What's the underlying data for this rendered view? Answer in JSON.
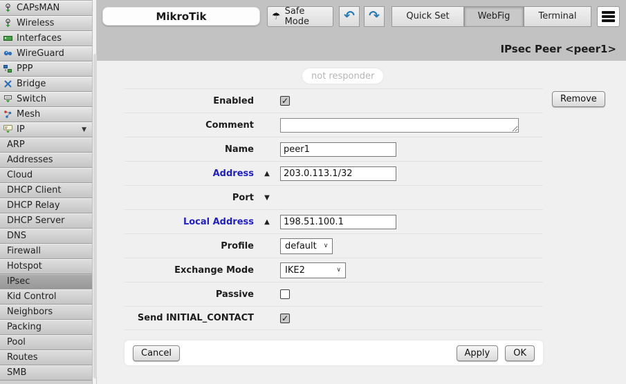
{
  "header": {
    "brand": "MikroTik",
    "safe_mode_label": "Safe Mode",
    "quick_set_label": "Quick Set",
    "webfig_label": "WebFig",
    "terminal_label": "Terminal"
  },
  "page": {
    "title": "IPsec Peer <peer1>",
    "status_badge": "not responder"
  },
  "sidebar": {
    "items": [
      {
        "label": "CAPsMAN",
        "icon": "antenna"
      },
      {
        "label": "Wireless",
        "icon": "antenna"
      },
      {
        "label": "Interfaces",
        "icon": "interface-card"
      },
      {
        "label": "WireGuard",
        "icon": "wireguard"
      },
      {
        "label": "PPP",
        "icon": "ppp"
      },
      {
        "label": "Bridge",
        "icon": "bridge"
      },
      {
        "label": "Switch",
        "icon": "switch"
      },
      {
        "label": "Mesh",
        "icon": "mesh"
      },
      {
        "label": "IP",
        "icon": "ip-label",
        "expanded": true
      }
    ],
    "subitems": [
      {
        "label": "ARP"
      },
      {
        "label": "Addresses"
      },
      {
        "label": "Cloud"
      },
      {
        "label": "DHCP Client"
      },
      {
        "label": "DHCP Relay"
      },
      {
        "label": "DHCP Server"
      },
      {
        "label": "DNS"
      },
      {
        "label": "Firewall"
      },
      {
        "label": "Hotspot"
      },
      {
        "label": "IPsec",
        "selected": true
      },
      {
        "label": "Kid Control"
      },
      {
        "label": "Neighbors"
      },
      {
        "label": "Packing"
      },
      {
        "label": "Pool"
      },
      {
        "label": "Routes"
      },
      {
        "label": "SMB"
      }
    ]
  },
  "form": {
    "enabled_label": "Enabled",
    "enabled_checked": true,
    "comment_label": "Comment",
    "comment_value": "",
    "name_label": "Name",
    "name_value": "peer1",
    "address_label": "Address",
    "address_value": "203.0.113.1/32",
    "port_label": "Port",
    "local_address_label": "Local Address",
    "local_address_value": "198.51.100.1",
    "profile_label": "Profile",
    "profile_value": "default",
    "exchange_mode_label": "Exchange Mode",
    "exchange_mode_value": "IKE2",
    "passive_label": "Passive",
    "passive_checked": false,
    "send_initial_contact_label": "Send INITIAL_CONTACT",
    "send_initial_contact_checked": true
  },
  "buttons": {
    "remove": "Remove",
    "cancel": "Cancel",
    "apply": "Apply",
    "ok": "OK"
  },
  "icons": {
    "check": "✓",
    "triangle_up": "▲",
    "triangle_down": "▼",
    "chevron_down": "∨",
    "undo": "↶",
    "redo": "↷",
    "umbrella": "☂"
  },
  "colors": {
    "header_bg": "#c2c2c2",
    "accent_label": "#2020bb",
    "arrow_blue": "#2a7ab5",
    "content_bg": "#f0f0f0"
  }
}
